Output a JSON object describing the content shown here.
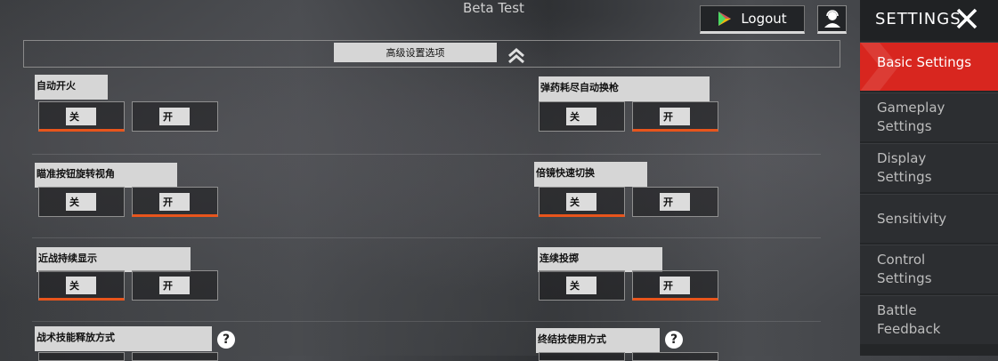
{
  "header": {
    "title": "Beta Test",
    "logout_label": "Logout"
  },
  "advanced_section": {
    "label": "高级设置选项"
  },
  "settings": {
    "auto_fire": {
      "label": "自动开火",
      "off": "关",
      "on": "开",
      "selected": "off"
    },
    "auto_reload": {
      "label": "弹药耗尽自动换枪",
      "off": "关",
      "on": "开",
      "selected": "on"
    },
    "aim_rotate": {
      "label": "瞄准按钮旋转视角",
      "off": "关",
      "on": "开",
      "selected": "on"
    },
    "scope_switch": {
      "label": "倍镜快速切换",
      "off": "关",
      "on": "开",
      "selected": "off"
    },
    "melee_display": {
      "label": "近战持续显示",
      "off": "关",
      "on": "开",
      "selected": "off"
    },
    "continuous_throw": {
      "label": "连续投掷",
      "off": "关",
      "on": "开",
      "selected": "on"
    },
    "tactical_mode": {
      "label": "战术技能释放方式"
    },
    "ultimate_mode": {
      "label": "终结技使用方式"
    }
  },
  "sidebar": {
    "title": "SETTINGS",
    "items": [
      {
        "label": "Basic Settings",
        "active": true
      },
      {
        "label": "Gameplay Settings",
        "active": false
      },
      {
        "label": "Display Settings",
        "active": false
      },
      {
        "label": "Sensitivity",
        "active": false
      },
      {
        "label": "Control Settings",
        "active": false
      },
      {
        "label": "Battle Feedback",
        "active": false
      }
    ]
  },
  "colors": {
    "accent": "#e8551c",
    "active_tab": "#d8261f"
  }
}
